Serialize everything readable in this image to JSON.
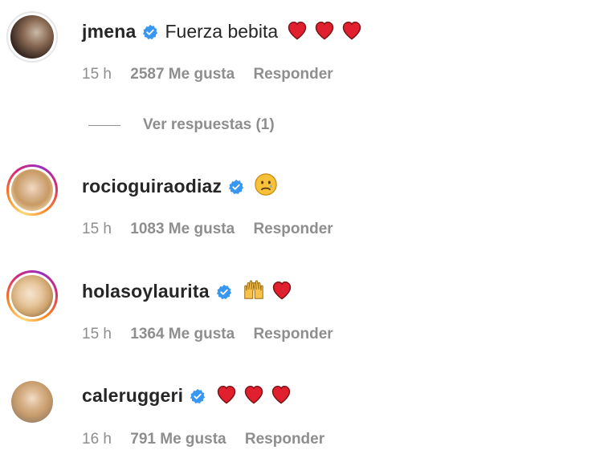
{
  "comments": [
    {
      "username": "jmena",
      "text": "Fuerza bebita",
      "emojis": [
        "heart-red",
        "heart-red",
        "heart-red"
      ],
      "time": "15 h",
      "likes": "2587 Me gusta",
      "reply": "Responder",
      "view_replies": "Ver respuestas (1)"
    },
    {
      "username": "rociogui­raodiaz",
      "text": "",
      "emojis": [
        "sad-face"
      ],
      "time": "15 h",
      "likes": "1083 Me gusta",
      "reply": "Responder"
    },
    {
      "username": "holasoylaurita",
      "text": "",
      "emojis": [
        "raising-hands",
        "heart-red"
      ],
      "time": "15 h",
      "likes": "1364 Me gusta",
      "reply": "Responder"
    },
    {
      "username": "caleruggeri",
      "text": "",
      "emojis": [
        "heart-red",
        "heart-red",
        "heart-red"
      ],
      "time": "16 h",
      "likes": "791 Me gusta",
      "reply": "Responder"
    }
  ],
  "colors": {
    "verified": "#3897f0",
    "heart": "#e0202e",
    "secondary_text": "#8e8e8e",
    "primary_text": "#262626"
  }
}
